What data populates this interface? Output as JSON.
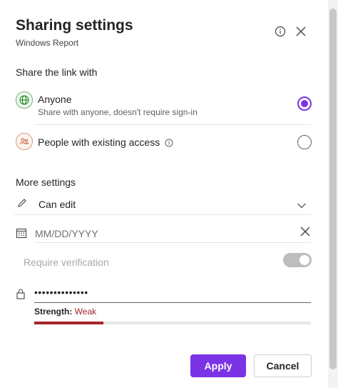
{
  "header": {
    "title": "Sharing settings",
    "subtitle": "Windows Report",
    "info_icon": "info-icon",
    "close_icon": "close-icon"
  },
  "share": {
    "section_label": "Share the link with",
    "options": [
      {
        "title": "Anyone",
        "description": "Share with anyone, doesn't require sign-in",
        "icon": "globe-icon",
        "selected": true
      },
      {
        "title": "People with existing access",
        "description": "",
        "icon": "people-icon",
        "selected": false
      }
    ]
  },
  "more": {
    "section_label": "More settings",
    "permission": "Can edit",
    "date_placeholder": "MM/DD/YYYY",
    "verification_label": "Require verification",
    "verification_enabled": true,
    "password_value": "••••••••••••••",
    "strength_label": "Strength:",
    "strength_value": "Weak",
    "strength_level": 0.25
  },
  "footer": {
    "apply_label": "Apply",
    "cancel_label": "Cancel"
  },
  "colors": {
    "accent": "#7a33e6",
    "weak": "#a4262c"
  }
}
